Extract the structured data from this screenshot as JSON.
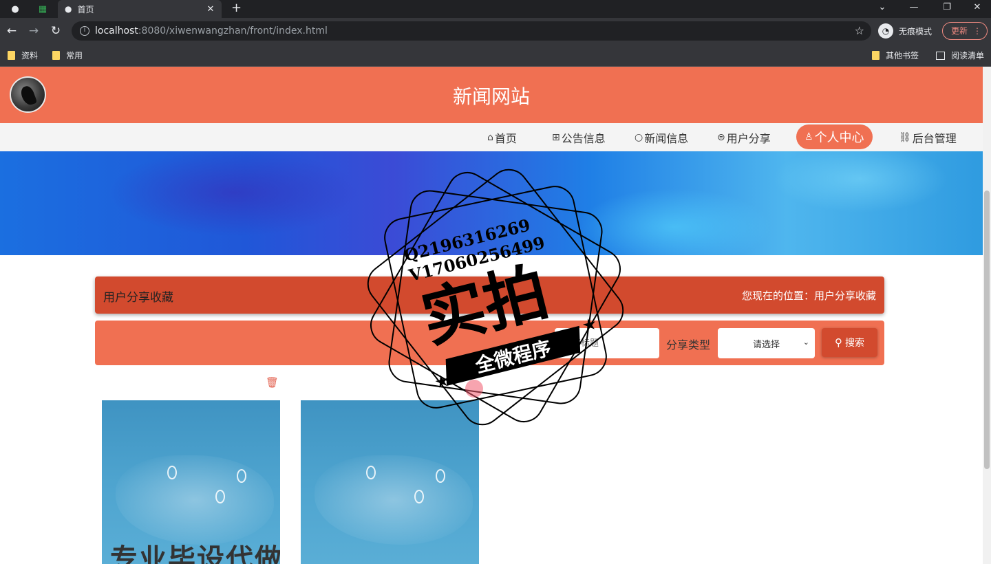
{
  "browser": {
    "tab_title": "首页",
    "url_host": "localhost",
    "url_rest": ":8080/xiwenwangzhan/front/index.html",
    "incognito_label": "无痕模式",
    "update_label": "更新",
    "bookmarks": [
      "资料",
      "常用"
    ],
    "bookmarks_right": [
      "其他书签",
      "阅读清单"
    ]
  },
  "site": {
    "title": "新闻网站",
    "nav": [
      {
        "icon": "home-icon",
        "label": "首页"
      },
      {
        "icon": "notice-icon",
        "label": "公告信息"
      },
      {
        "icon": "news-icon",
        "label": "新闻信息"
      },
      {
        "icon": "share-icon",
        "label": "用户分享"
      },
      {
        "icon": "user-icon",
        "label": "个人中心",
        "active": true
      },
      {
        "icon": "link-icon",
        "label": "后台管理"
      }
    ],
    "accent_color": "#f07052",
    "dark_accent_color": "#d24a2e"
  },
  "breadcrumb": {
    "title": "用户分享收藏",
    "position": "您现在的位置：用户分享收藏"
  },
  "search": {
    "input_placeholder": "分享标题",
    "type_label": "分享类型",
    "select_value": "请选择",
    "button_label": "搜索"
  },
  "cards": [
    {
      "caption": "专业毕设代做"
    },
    {
      "caption": ""
    }
  ],
  "watermark": {
    "line1": "Q2196316269",
    "line2": "V17060256499",
    "main": "实拍",
    "ribbon": "全微程序"
  }
}
